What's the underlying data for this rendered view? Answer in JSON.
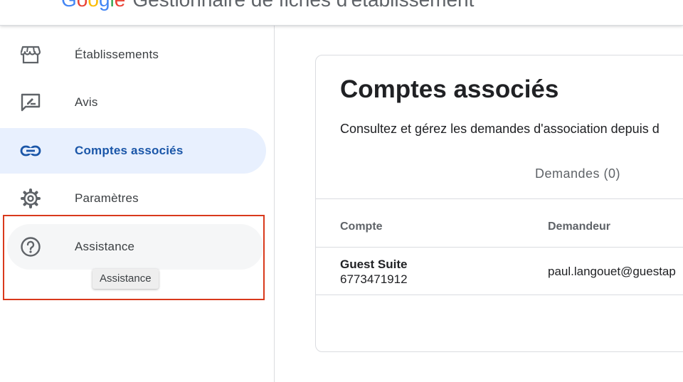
{
  "header": {
    "brand_letters": [
      "G",
      "o",
      "o",
      "g",
      "l",
      "e"
    ],
    "product": "Gestionnaire de fiches d'établissement"
  },
  "sidebar": {
    "items": [
      {
        "label": "Établissements",
        "icon": "store-icon"
      },
      {
        "label": "Avis",
        "icon": "rate-review-icon"
      },
      {
        "label": "Comptes associés",
        "icon": "link-icon",
        "active": true
      },
      {
        "label": "Paramètres",
        "icon": "gear-icon"
      },
      {
        "label": "Assistance",
        "icon": "help-circle-icon",
        "hovered": true
      }
    ],
    "tooltip": "Assistance"
  },
  "main": {
    "title": "Comptes associés",
    "description": "Consultez et gérez les demandes d'association depuis d",
    "tab": "Demandes (0)",
    "table": {
      "columns": [
        "Compte",
        "Demandeur"
      ],
      "rows": [
        {
          "account_name": "Guest Suite",
          "account_id": "6773471912",
          "requester": "paul.langouet@guestap"
        }
      ]
    }
  },
  "colors": {
    "active_bg": "#e8f0fe",
    "active_text": "#1a56a8",
    "highlight_border": "#d9391c",
    "divider": "#dadce0"
  }
}
